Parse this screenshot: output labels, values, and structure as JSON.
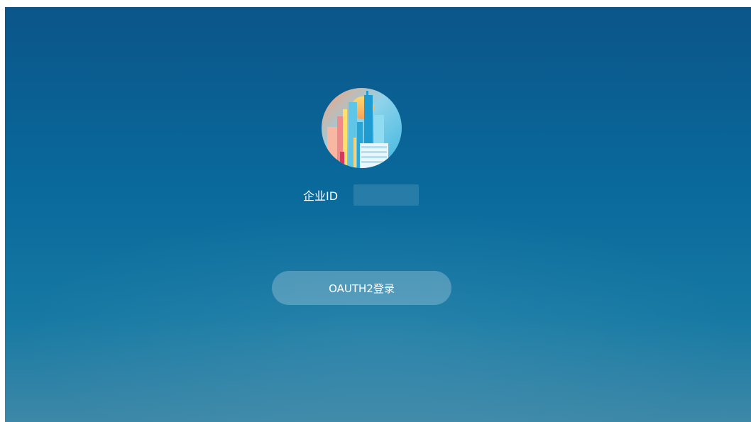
{
  "form": {
    "id_label": "企业ID",
    "id_value": "",
    "id_placeholder": ""
  },
  "login_button": {
    "label": "OAUTH2登录"
  },
  "colors": {
    "background_top": "#0b5589",
    "background_bottom": "#3d88a8",
    "button_fill": "rgba(255,255,255,0.24)",
    "text": "#ffffff"
  },
  "icons": {
    "logo": "city-skyline-logo-icon"
  }
}
